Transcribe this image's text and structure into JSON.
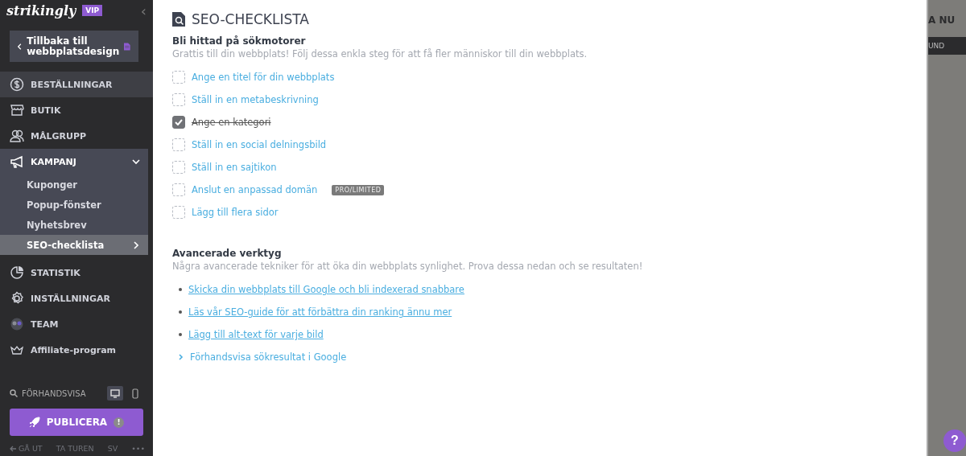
{
  "sidebar": {
    "logo": "strikingly",
    "badge": "VIP",
    "collapse": "‹",
    "back_button": "Tillbaka till webbplatsdesign",
    "items": [
      {
        "label": "BESTÄLLNINGAR",
        "selected": false,
        "hover": true
      },
      {
        "label": "BUTIK",
        "selected": false,
        "hover": false
      },
      {
        "label": "MÅLGRUPP",
        "selected": false,
        "hover": false
      },
      {
        "label": "KAMPANJ",
        "selected": false,
        "hover": false,
        "expanded": true,
        "children": [
          {
            "label": "Kuponger",
            "selected": false
          },
          {
            "label": "Popup-fönster",
            "selected": false
          },
          {
            "label": "Nyhetsbrev",
            "selected": false
          },
          {
            "label": "SEO-checklista",
            "selected": true
          }
        ]
      },
      {
        "label": "STATISTIK",
        "selected": false,
        "hover": false
      },
      {
        "label": "INSTÄLLNINGAR",
        "selected": false,
        "hover": false
      },
      {
        "label": "TEAM",
        "selected": false,
        "hover": false
      },
      {
        "label": "Affiliate-program",
        "selected": false,
        "hover": false
      }
    ],
    "preview": "FÖRHANDSVISA",
    "devices": [
      {
        "kind": "desktop",
        "selected": true
      },
      {
        "kind": "mobile",
        "selected": false
      }
    ],
    "publish": "PUBLICERA",
    "publish_alert": "!",
    "footer": [
      {
        "label": "GÅ UT",
        "kind": "exit"
      },
      {
        "label": "TA TUREN",
        "kind": "text"
      },
      {
        "label": "SV",
        "kind": "text"
      },
      {
        "label": "•••",
        "kind": "text"
      }
    ]
  },
  "panel": {
    "title": "SEO-CHECKLISTA",
    "section1": {
      "heading": "Bli hittad på sökmotorer",
      "description": "Grattis till din webbplats! Följ dessa enkla steg för att få fler människor till din webbplats.",
      "tasks": [
        {
          "label": "Ange en titel för din webbplats",
          "checked": false
        },
        {
          "label": "Ställ in en metabeskrivning",
          "checked": false
        },
        {
          "label": "Ange en kategori",
          "checked": true
        },
        {
          "label": "Ställ in en social delningsbild",
          "checked": false
        },
        {
          "label": "Ställ in en sajtikon",
          "checked": false
        },
        {
          "label": "Anslut en anpassad domän",
          "checked": false,
          "badge": "PRO/LIMITED"
        },
        {
          "label": "Lägg till flera sidor",
          "checked": false
        }
      ]
    },
    "section2": {
      "heading": "Avancerade verktyg",
      "description": "Några avancerade tekniker för att öka din webbplats synlighet. Prova dessa nedan och se resultaten!",
      "links": [
        {
          "label": "Skicka din webbplats till Google och bli indexerad snabbare",
          "kind": "bullet"
        },
        {
          "label": "Läs vår SEO-guide för att förbättra din ranking ännu mer",
          "kind": "bullet"
        },
        {
          "label": "Lägg till alt-text för varje bild",
          "kind": "bullet"
        },
        {
          "label": "Förhandsvisa sökresultat i Google",
          "kind": "expand"
        }
      ]
    }
  },
  "backdrop": {
    "top_text": "A NU",
    "bar_text": "UND",
    "help": "?"
  }
}
